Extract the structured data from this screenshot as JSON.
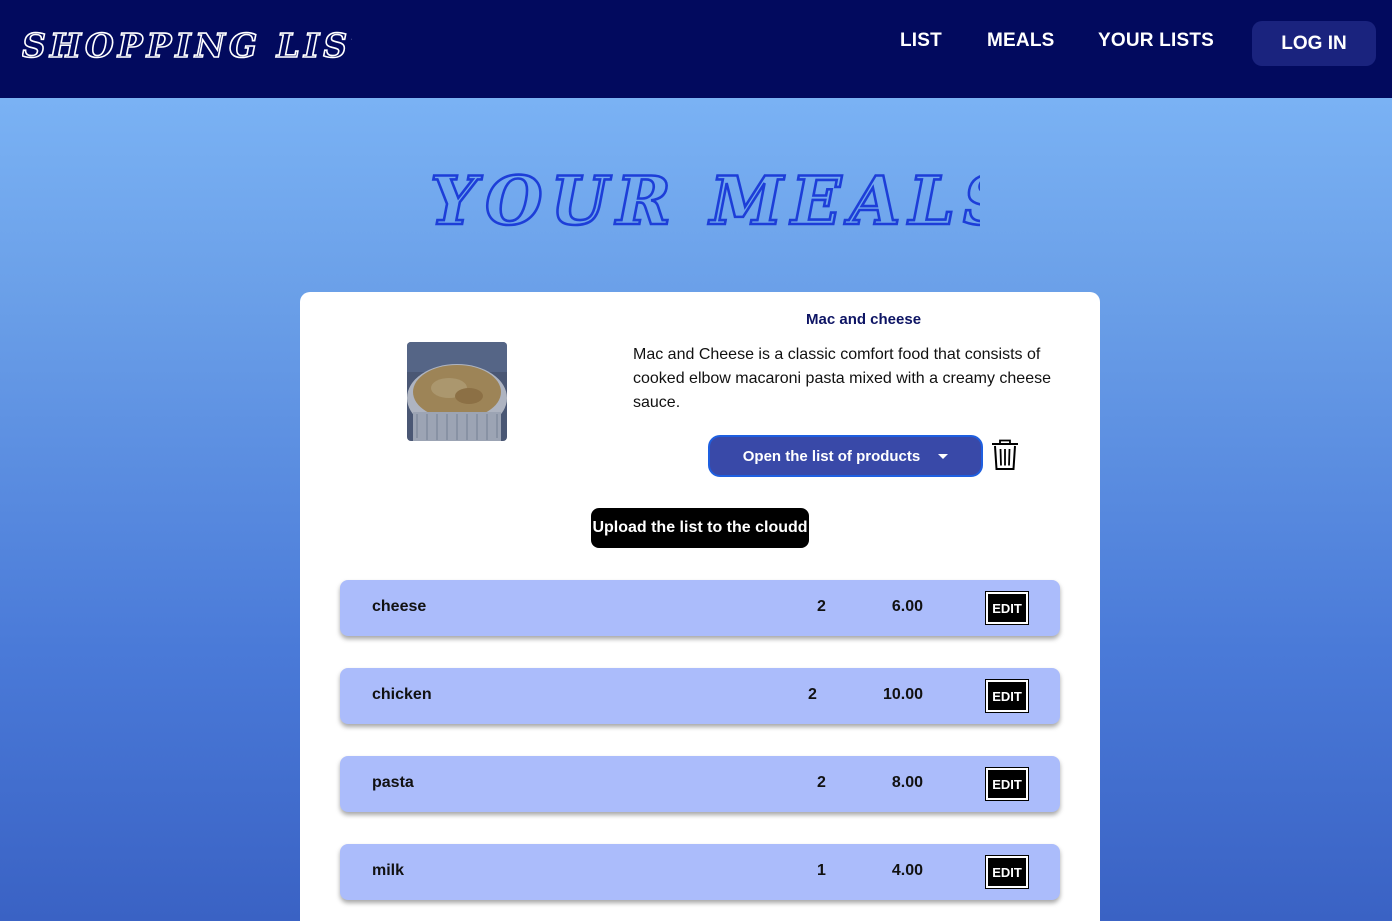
{
  "header": {
    "logo_text": "SHOPPING LIST",
    "nav": [
      {
        "label": "LIST"
      },
      {
        "label": "MEALS"
      },
      {
        "label": "YOUR LISTS"
      }
    ],
    "login_label": "LOG IN"
  },
  "page": {
    "title": "YOUR MEALS"
  },
  "meal": {
    "name": "Mac and cheese",
    "description": "Mac and Cheese is a classic comfort food that consists of cooked elbow macaroni pasta mixed with a creamy cheese sauce.",
    "open_list_label": "Open the list of products",
    "upload_label": "Upload the list to the cloudd",
    "items": [
      {
        "name": "cheese",
        "qty": "2",
        "price": "6.00",
        "edit": "EDIT"
      },
      {
        "name": "chicken",
        "qty": "2",
        "price": "10.00",
        "edit": "EDIT"
      },
      {
        "name": "pasta",
        "qty": "2",
        "price": "8.00",
        "edit": "EDIT"
      },
      {
        "name": "milk",
        "qty": "1",
        "price": "4.00",
        "edit": "EDIT"
      }
    ]
  },
  "colors": {
    "header_bg": "#020a5e",
    "login_bg": "#1a237e",
    "title_color": "#1d3ed8",
    "row_bg": "#abbcfb",
    "dropdown_bg": "#3949a8"
  },
  "icons": {
    "delete": "trash-icon",
    "dropdown": "caret-down-icon"
  }
}
